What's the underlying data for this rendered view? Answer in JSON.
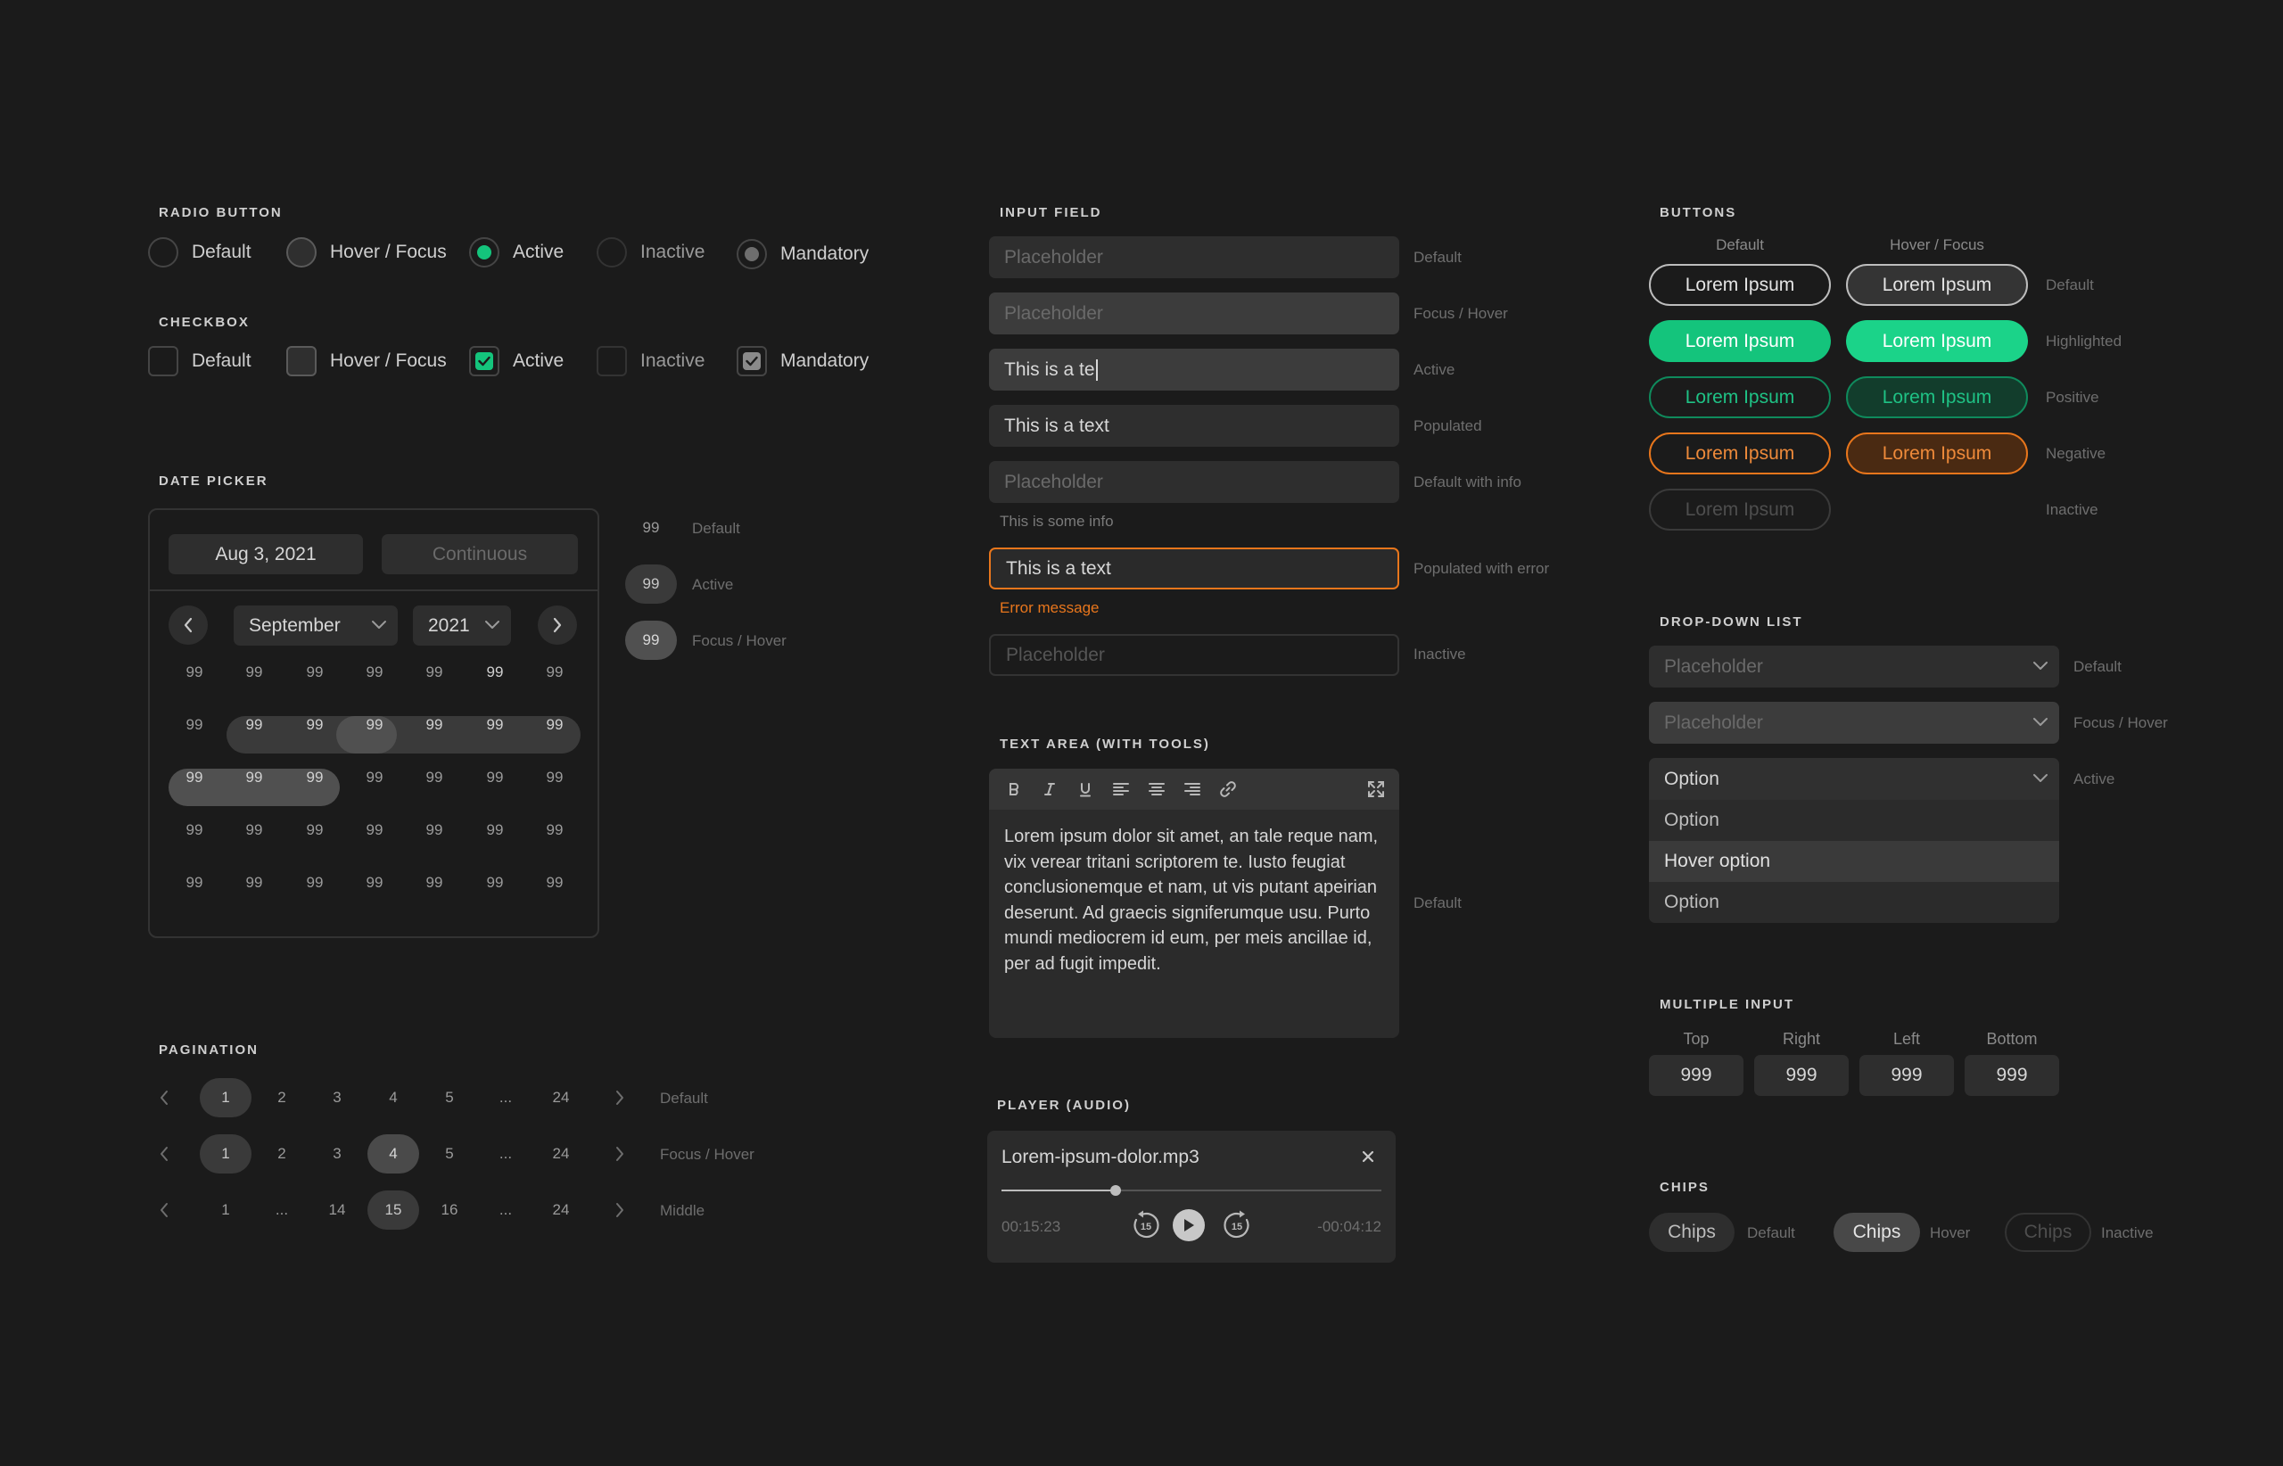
{
  "radio": {
    "title": "RADIO BUTTON",
    "items": [
      {
        "label": "Default"
      },
      {
        "label": "Hover / Focus"
      },
      {
        "label": "Active"
      },
      {
        "label": "Inactive"
      },
      {
        "label": "Mandatory"
      }
    ]
  },
  "checkbox": {
    "title": "CHECKBOX",
    "items": [
      {
        "label": "Default"
      },
      {
        "label": "Hover / Focus"
      },
      {
        "label": "Active"
      },
      {
        "label": "Inactive"
      },
      {
        "label": "Mandatory"
      }
    ]
  },
  "datepicker": {
    "title": "DATE PICKER",
    "date_value": "Aug 3, 2021",
    "continuous_placeholder": "Continuous",
    "month": "September",
    "year": "2021",
    "day_label": "99",
    "states": [
      {
        "value": "99",
        "label": "Default"
      },
      {
        "value": "99",
        "label": "Active"
      },
      {
        "value": "99",
        "label": "Focus / Hover"
      }
    ]
  },
  "pagination": {
    "title": "PAGINATION",
    "rows": [
      {
        "label": "Default",
        "pages": [
          "1",
          "2",
          "3",
          "4",
          "5",
          "...",
          "24"
        ]
      },
      {
        "label": "Focus / Hover",
        "pages": [
          "1",
          "2",
          "3",
          "4",
          "5",
          "...",
          "24"
        ]
      },
      {
        "label": "Middle",
        "pages": [
          "1",
          "...",
          "14",
          "15",
          "16",
          "...",
          "24"
        ]
      }
    ]
  },
  "input_field": {
    "title": "INPUT FIELD",
    "rows": [
      {
        "value": "Placeholder",
        "label": "Default"
      },
      {
        "value": "Placeholder",
        "label": "Focus / Hover"
      },
      {
        "value": "This is a te",
        "label": "Active"
      },
      {
        "value": "This is a text",
        "label": "Populated"
      },
      {
        "value": "Placeholder",
        "label": "Default with info"
      },
      {
        "value": "This is a text",
        "label": "Populated with error"
      },
      {
        "value": "Placeholder",
        "label": "Inactive"
      }
    ],
    "info": "This is some info",
    "error": "Error message"
  },
  "text_area": {
    "title": "TEXT AREA (WITH TOOLS)",
    "text": "Lorem ipsum dolor sit amet, an tale reque nam, vix verear tritani scriptorem te. Iusto feugiat conclusionemque et nam, ut vis putant apeirian deserunt. Ad graecis signiferumque usu. Purto mundi mediocrem id eum, per meis ancillae id, per ad fugit impedit.",
    "label": "Default",
    "tools": [
      "bold-icon",
      "italic-icon",
      "underline-icon",
      "align-left-icon",
      "align-center-icon",
      "align-right-icon",
      "link-icon",
      "expand-icon"
    ]
  },
  "player": {
    "title": "PLAYER (AUDIO)",
    "file": "Lorem-ipsum-dolor.mp3",
    "elapsed": "00:15:23",
    "remaining": "-00:04:12",
    "skip": "15",
    "progress": 0.3
  },
  "buttons": {
    "title": "BUTTONS",
    "col_default": "Default",
    "col_hover": "Hover / Focus",
    "label": "Lorem Ipsum",
    "rows": [
      {
        "label": "Default"
      },
      {
        "label": "Highlighted"
      },
      {
        "label": "Positive"
      },
      {
        "label": "Negative"
      },
      {
        "label": "Inactive"
      }
    ]
  },
  "dropdown": {
    "title": "DROP-DOWN LIST",
    "rows": [
      {
        "value": "Placeholder",
        "label": "Default"
      },
      {
        "value": "Placeholder",
        "label": "Focus / Hover"
      },
      {
        "value": "Option",
        "label": "Active"
      }
    ],
    "options": [
      "Option",
      "Hover option",
      "Option"
    ]
  },
  "multiple_input": {
    "title": "MULTIPLE INPUT",
    "fields": [
      {
        "label": "Top",
        "value": "999"
      },
      {
        "label": "Right",
        "value": "999"
      },
      {
        "label": "Left",
        "value": "999"
      },
      {
        "label": "Bottom",
        "value": "999"
      }
    ]
  },
  "chips": {
    "title": "CHIPS",
    "items": [
      {
        "text": "Chips",
        "label": "Default"
      },
      {
        "text": "Chips",
        "label": "Hover"
      },
      {
        "text": "Chips",
        "label": "Inactive"
      }
    ]
  },
  "colors": {
    "background": "#1b1b1b",
    "accent_green": "#14c47c",
    "error_orange": "#e8761c"
  }
}
